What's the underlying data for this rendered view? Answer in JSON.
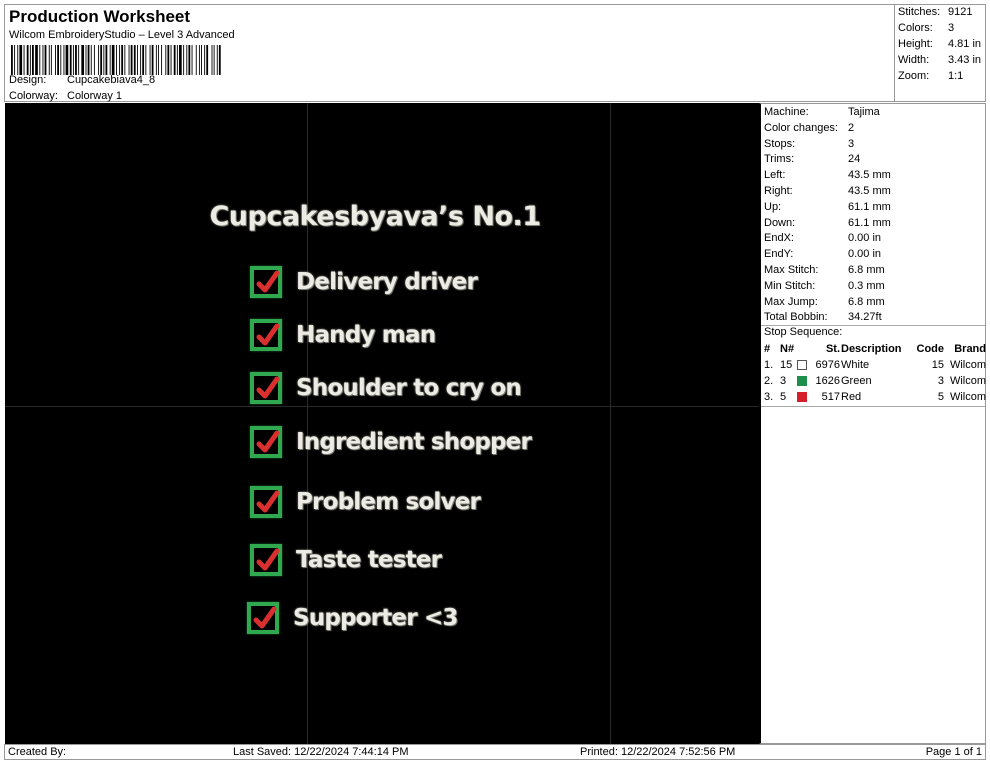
{
  "header": {
    "title": "Production Worksheet",
    "subtitle": "Wilcom EmbroideryStudio – Level 3 Advanced",
    "design_label": "Design:",
    "design_value": "Cupcakebiava4_8",
    "colorway_label": "Colorway:",
    "colorway_value": "Colorway 1"
  },
  "summary": {
    "stitches_label": "Stitches:",
    "stitches_value": "9121",
    "colors_label": "Colors:",
    "colors_value": "3",
    "height_label": "Height:",
    "height_value": "4.81 in",
    "width_label": "Width:",
    "width_value": "3.43 in",
    "zoom_label": "Zoom:",
    "zoom_value": "1:1"
  },
  "design": {
    "title": "Cupcakesbyava’s No.1",
    "items": [
      "Delivery driver",
      "Handy man",
      "Shoulder to cry on",
      "Ingredient shopper",
      "Problem solver",
      "Taste tester",
      "Supporter <3"
    ],
    "colors": {
      "background": "#000000",
      "text": "#ecebe4",
      "box": "#2fa84f",
      "check": "#d9302f"
    }
  },
  "machine_info": [
    {
      "label": "Machine:",
      "value": "Tajima"
    },
    {
      "label": "Color changes:",
      "value": "2"
    },
    {
      "label": "Stops:",
      "value": "3"
    },
    {
      "label": "Trims:",
      "value": "24"
    },
    {
      "label": "Left:",
      "value": "43.5 mm"
    },
    {
      "label": "Right:",
      "value": "43.5 mm"
    },
    {
      "label": "Up:",
      "value": "61.1 mm"
    },
    {
      "label": "Down:",
      "value": "61.1 mm"
    },
    {
      "label": "EndX:",
      "value": "0.00 in"
    },
    {
      "label": "EndY:",
      "value": "0.00 in"
    },
    {
      "label": "Max Stitch:",
      "value": "6.8 mm"
    },
    {
      "label": "Min Stitch:",
      "value": "0.3 mm"
    },
    {
      "label": "Max Jump:",
      "value": "6.8 mm"
    },
    {
      "label": "Total Bobbin:",
      "value": "34.27ft"
    }
  ],
  "stop_sequence": {
    "title": "Stop Sequence:",
    "headers": {
      "num": "#",
      "n": "N#",
      "st": "St.",
      "desc": "Description",
      "code": "Code",
      "brand": "Brand"
    },
    "rows": [
      {
        "num": "1.",
        "n": "15",
        "color": "#ffffff",
        "st": "6976",
        "desc": "White",
        "code": "15",
        "brand": "Wilcom"
      },
      {
        "num": "2.",
        "n": "3",
        "color": "#1e8f4a",
        "st": "1626",
        "desc": "Green",
        "code": "3",
        "brand": "Wilcom"
      },
      {
        "num": "3.",
        "n": "5",
        "color": "#d4202a",
        "st": "517",
        "desc": "Red",
        "code": "5",
        "brand": "Wilcom"
      }
    ]
  },
  "footer": {
    "created_by": "Created By:",
    "last_saved": "Last Saved: 12/22/2024 7:44:14 PM",
    "printed": "Printed: 12/22/2024 7:52:56 PM",
    "page": "Page 1 of 1"
  }
}
